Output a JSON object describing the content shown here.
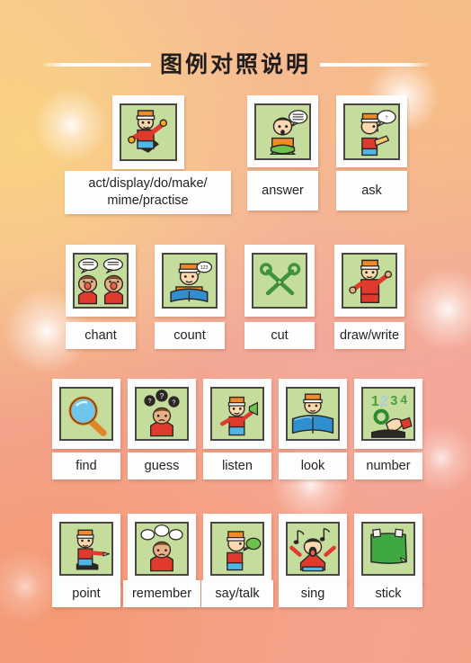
{
  "page": {
    "title": "图例对照说明",
    "background_colors": {
      "top_left": "#f7c98c",
      "top_right": "#f6bd8b",
      "middle": "#f2a999",
      "bottom": "#f3a184",
      "accent_pink": "#f4a5a0"
    },
    "card_bg": "#fdfdfd",
    "thumb_bg": "#c4dd9c",
    "thumb_border": "#4a4742",
    "text_color": "#262322"
  },
  "rows": [
    {
      "id": "row-1",
      "items": [
        {
          "label": "act/display/do/make/\nmime/practise",
          "icon": "boy-acting-icon"
        },
        {
          "label": "answer",
          "icon": "boy-speech-bubble-icon"
        },
        {
          "label": "ask",
          "icon": "boy-question-bubble-icon"
        }
      ]
    },
    {
      "id": "row-2",
      "items": [
        {
          "label": "chant",
          "icon": "two-kids-chanting-icon"
        },
        {
          "label": "count",
          "icon": "boy-reading-counting-icon"
        },
        {
          "label": "cut",
          "icon": "scissors-icon"
        },
        {
          "label": "draw/write",
          "icon": "boy-drawing-icon"
        }
      ]
    },
    {
      "id": "row-3",
      "items": [
        {
          "label": "find",
          "icon": "magnifying-glass-icon"
        },
        {
          "label": "guess",
          "icon": "kid-question-marks-icon"
        },
        {
          "label": "listen",
          "icon": "boy-megaphone-icon"
        },
        {
          "label": "look",
          "icon": "boy-open-book-icon"
        },
        {
          "label": "number",
          "icon": "numbers-1234-icon"
        }
      ]
    },
    {
      "id": "row-4",
      "items": [
        {
          "label": "point",
          "icon": "boy-pointing-icon"
        },
        {
          "label": "remember",
          "icon": "kid-thought-bubbles-icon"
        },
        {
          "label": "say/talk",
          "icon": "boy-talking-bubble-icon"
        },
        {
          "label": "sing",
          "icon": "kid-singing-notes-icon"
        },
        {
          "label": "stick",
          "icon": "green-paper-sticker-icon"
        }
      ]
    }
  ]
}
